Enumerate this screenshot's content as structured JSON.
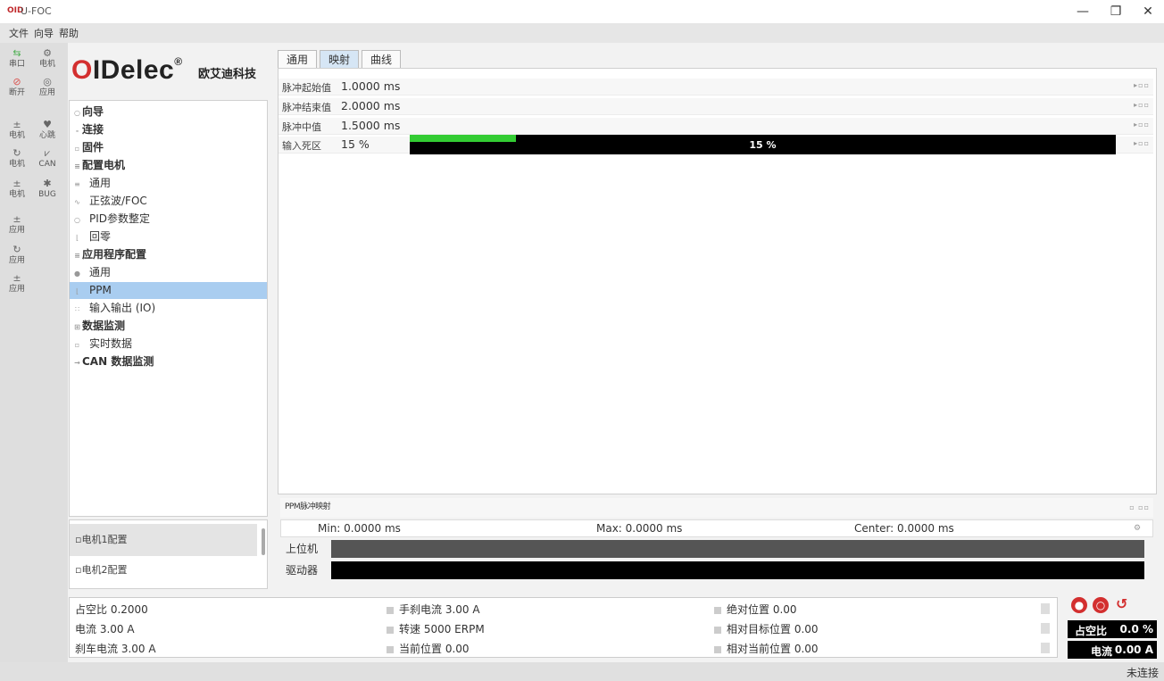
{
  "app": {
    "logo": "OID",
    "title": "U-FOC",
    "window": {
      "minimize": "—",
      "maximize": "❐",
      "close": "✕"
    }
  },
  "menu": [
    "文件",
    "向导",
    "帮助"
  ],
  "toolbar": [
    {
      "label": "串口",
      "icon": "connect-icon"
    },
    {
      "label": "电机",
      "icon": "motor-icon"
    },
    {
      "label": "断开",
      "icon": "disconnect-icon"
    },
    {
      "label": "应用",
      "icon": "apply-icon"
    },
    {
      "label": "电机",
      "icon": "upload-icon"
    },
    {
      "label": "心跳",
      "icon": "heart-icon"
    },
    {
      "label": "电机",
      "icon": "refresh-icon"
    },
    {
      "label": "CAN",
      "icon": "can-icon"
    },
    {
      "label": "电机",
      "icon": "upload-icon"
    },
    {
      "label": "BUG",
      "icon": "bug-icon"
    },
    {
      "label": "应用",
      "icon": "upload-icon"
    },
    {
      "label": "应用",
      "icon": "refresh-icon"
    },
    {
      "label": "应用",
      "icon": "upload-icon"
    }
  ],
  "brand": {
    "name_o": "O",
    "name_rest": "IDelec",
    "reg": "®",
    "cn": "欧艾迪科技"
  },
  "nav": [
    {
      "label": "向导",
      "level": 1
    },
    {
      "label": "连接",
      "level": 1
    },
    {
      "label": "固件",
      "level": 1
    },
    {
      "label": "配置电机",
      "level": 1
    },
    {
      "label": "通用",
      "level": 2
    },
    {
      "label": "正弦波/FOC",
      "level": 2
    },
    {
      "label": "PID参数整定",
      "level": 2
    },
    {
      "label": "回零",
      "level": 2
    },
    {
      "label": "应用程序配置",
      "level": 1
    },
    {
      "label": "通用",
      "level": 2
    },
    {
      "label": "PPM",
      "level": 2,
      "selected": true
    },
    {
      "label": "输入输出 (IO)",
      "level": 2
    },
    {
      "label": "数据监测",
      "level": 1
    },
    {
      "label": "实时数据",
      "level": 2
    },
    {
      "label": "CAN 数据监测",
      "level": 1
    }
  ],
  "motors": [
    "电机1配置",
    "电机2配置"
  ],
  "tabs": [
    "通用",
    "映射",
    "曲线"
  ],
  "params": [
    {
      "label": "脉冲起始值",
      "value": "1.0000 ms"
    },
    {
      "label": "脉冲结束值",
      "value": "2.0000 ms"
    },
    {
      "label": "脉冲中值",
      "value": "1.5000 ms"
    },
    {
      "label": "输入死区",
      "value": "15 %"
    }
  ],
  "deadzone": {
    "percent": 15,
    "text": "15 %"
  },
  "mapping": {
    "title": "PPM脉冲映射",
    "min": "Min: 0.0000 ms",
    "max": "Max: 0.0000 ms",
    "center": "Center: 0.0000 ms",
    "bar1_label": "上位机",
    "bar2_label": "驱动器"
  },
  "status": {
    "col1": [
      "占空比 0.2000",
      "电流 3.00 A",
      "刹车电流 3.00 A"
    ],
    "col2": [
      "手刹电流 3.00 A",
      "转速 5000 ERPM",
      "当前位置 0.00"
    ],
    "col3": [
      "绝对位置 0.00",
      "相对目标位置 0.00",
      "相对当前位置 0.00"
    ],
    "duty": {
      "label": "占空比",
      "value": "0.0 %"
    },
    "current": {
      "label": "电流",
      "value": "0.00 A"
    }
  },
  "connection": "未连接",
  "colors": {
    "accent": "#d32f2f",
    "progress": "#33cc33",
    "selected": "#a9cdf0"
  }
}
